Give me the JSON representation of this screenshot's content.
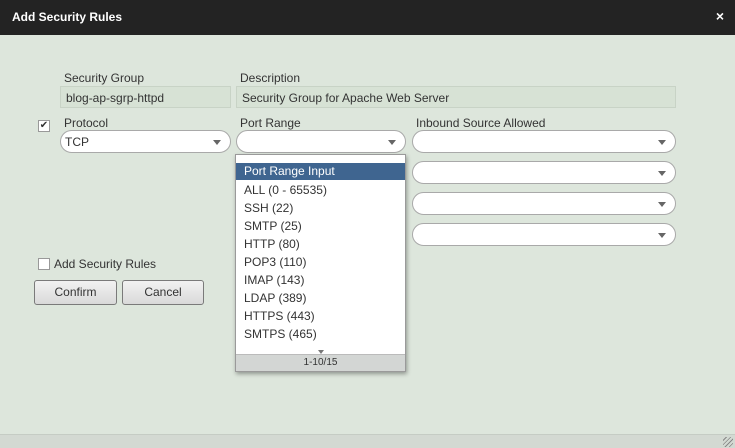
{
  "dialog": {
    "title": "Add Security Rules",
    "close_glyph": "×"
  },
  "form": {
    "security_group_label": "Security Group",
    "security_group_value": "blog-ap-sgrp-httpd",
    "description_label": "Description",
    "description_value": "Security Group for Apache Web Server",
    "protocol_checked_glyph": "✔",
    "protocol_label": "Protocol",
    "protocol_value": "TCP",
    "port_range_label": "Port Range",
    "port_range_value": "",
    "inbound_label": "Inbound Source Allowed",
    "add_rules_label": "Add Security Rules"
  },
  "dropdown": {
    "options": [
      "Port Range Input",
      "ALL (0 - 65535)",
      "SSH (22)",
      "SMTP (25)",
      "HTTP (80)",
      "POP3 (110)",
      "IMAP (143)",
      "LDAP (389)",
      "HTTPS (443)",
      "SMTPS (465)"
    ],
    "selected_index": 0,
    "pager": "1-10/15"
  },
  "buttons": {
    "confirm": "Confirm",
    "cancel": "Cancel"
  }
}
